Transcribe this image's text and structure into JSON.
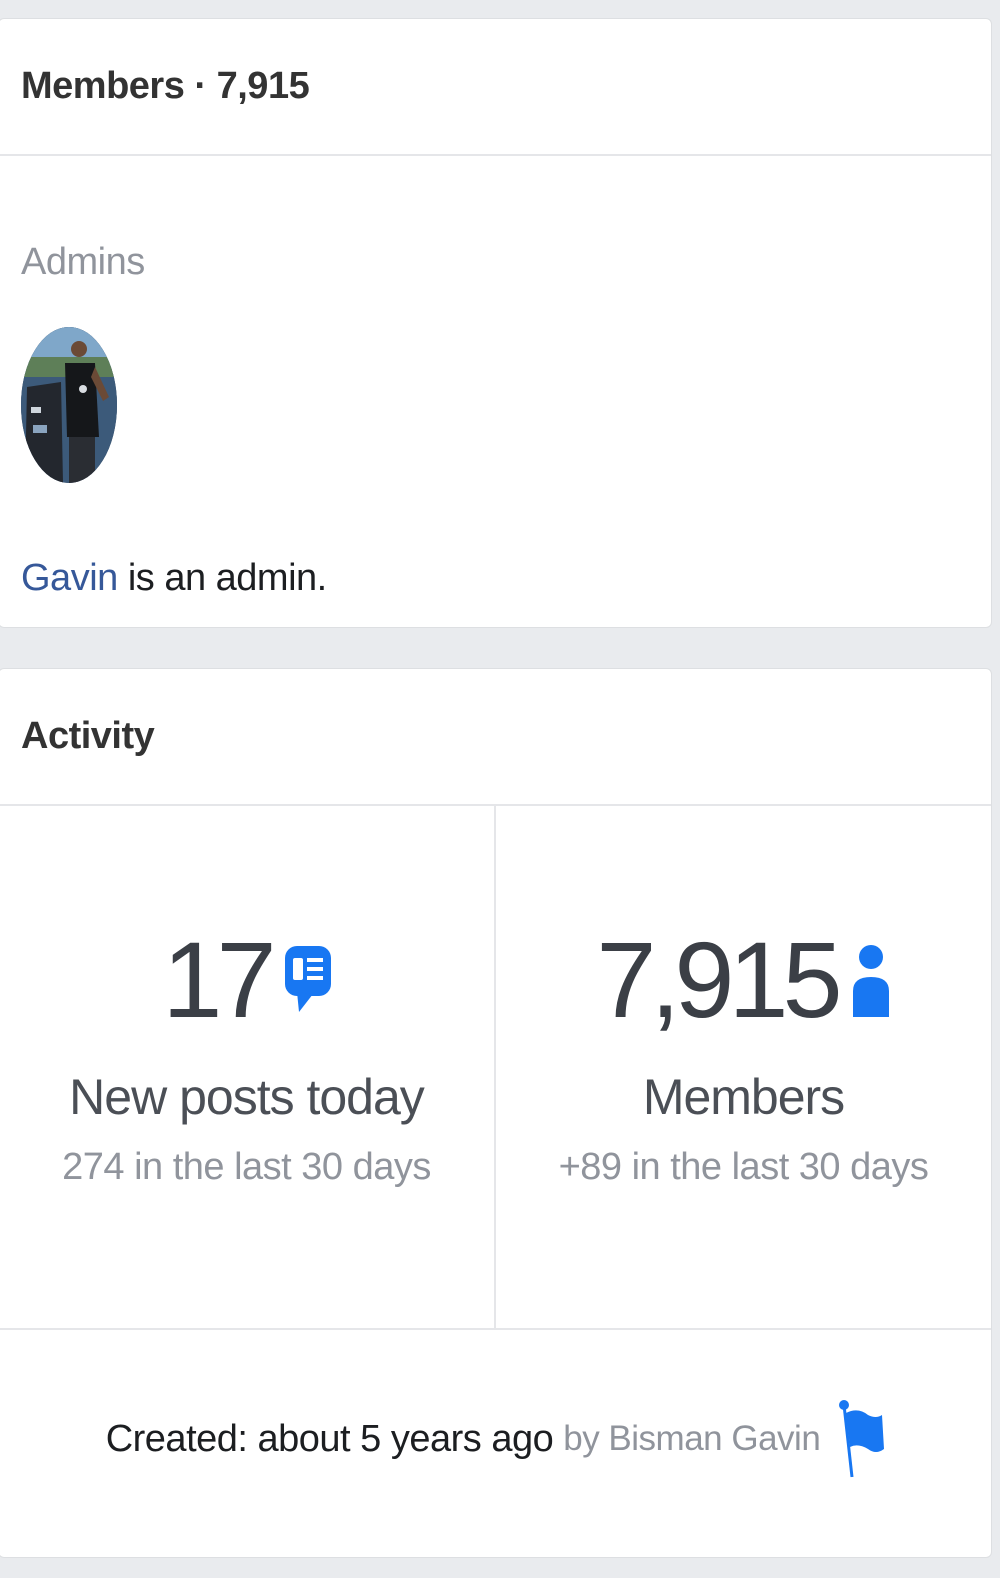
{
  "members_card": {
    "header": "Members · 7,915",
    "admins_label": "Admins",
    "admin_name": "Gavin",
    "admin_suffix": " is an admin."
  },
  "activity_card": {
    "header": "Activity",
    "posts": {
      "number": "17",
      "label": "New posts today",
      "sub": "274 in the last 30 days",
      "icon": "speech-bubble-icon"
    },
    "members": {
      "number": "7,915",
      "label": "Members",
      "sub": "+89 in the last 30 days",
      "icon": "person-icon"
    },
    "created": {
      "main": "Created: about 5 years ago",
      "by": "by Bisman Gavin",
      "icon": "flag-icon"
    }
  },
  "colors": {
    "accent": "#1877f2",
    "link": "#365899",
    "muted": "#90949c",
    "background": "#e9ebee"
  }
}
